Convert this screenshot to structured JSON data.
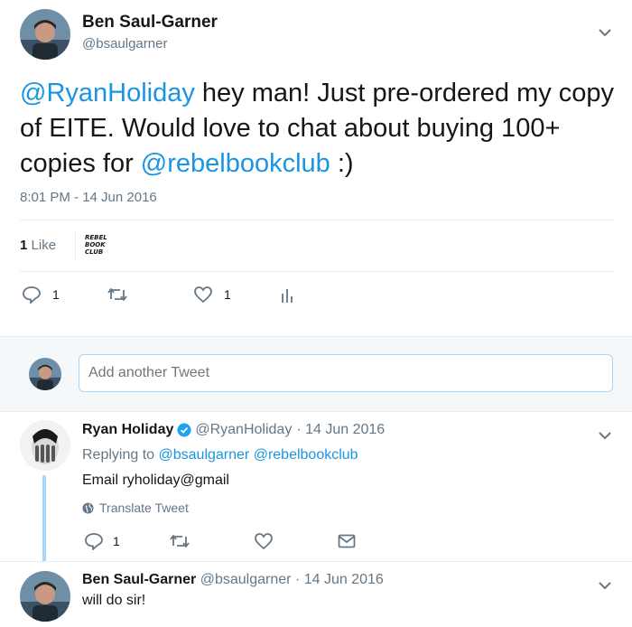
{
  "main_tweet": {
    "author_name": "Ben Saul-Garner",
    "author_handle": "@bsaulgarner",
    "mention1": "@RyanHoliday",
    "text1": " hey man! Just pre-ordered my copy of EITE. Would love to chat about buying 100+ copies for ",
    "mention2": "@rebelbookclub",
    "text2": " :)",
    "timestamp": "8:01 PM - 14 Jun 2016",
    "likes_count": "1",
    "likes_label": "Like",
    "liker_logo_text": [
      "REBEL",
      "BOOK",
      "CLUB"
    ],
    "reply_count": "1",
    "like_count": "1"
  },
  "compose": {
    "placeholder": "Add another Tweet"
  },
  "reply1": {
    "author_name": "Ryan Holiday",
    "author_handle": "@RyanHoliday",
    "date": "· 14 Jun 2016",
    "replying_label": "Replying to",
    "replying_to1": "@bsaulgarner",
    "replying_to2": "@rebelbookclub",
    "text": "Email ryholiday@gmail",
    "translate_label": "Translate Tweet",
    "reply_count": "1"
  },
  "reply2": {
    "author_name": "Ben Saul-Garner",
    "author_handle": "@bsaulgarner",
    "date": "· 14 Jun 2016",
    "text": "will do sir!"
  },
  "colors": {
    "link": "#1b95e0",
    "secondary_text": "#657786",
    "divider": "#e6ecf0",
    "compose_bg": "#f5f8fa",
    "verified": "#1da1f2"
  }
}
